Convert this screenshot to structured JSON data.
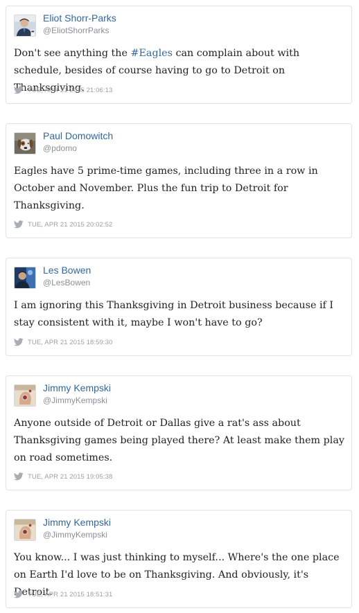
{
  "feed": {
    "tweets": [
      {
        "name": "Eliot Shorr-Parks",
        "handle": "@EliotShorrParks",
        "text_before": "Don't see anything the ",
        "hashtag": "#Eagles",
        "text_after": " can complain about with schedule, besides of course having to go to Detroit on Thanksgiving.",
        "timestamp": "TUE, APR 21 2015 21:06:13",
        "avatar_icon": "person-avatar-icon"
      },
      {
        "name": "Paul Domowitch",
        "handle": "@pdomo",
        "text": "Eagles have 5 prime-time games, including three in a row in October and November. Plus the fun trip to Detroit for Thanksgiving.",
        "timestamp": "TUE, APR 21 2015 20:02:52",
        "avatar_icon": "dog-avatar-icon"
      },
      {
        "name": "Les Bowen",
        "handle": "@LesBowen",
        "text": "I am ignoring this Thanksgiving in Detroit business because if I stay consistent with it, maybe I won't have to go?",
        "timestamp": "TUE, APR 21 2015 18:59:30",
        "avatar_icon": "person-avatar-icon"
      },
      {
        "name": "Jimmy Kempski",
        "handle": "@JimmyKempski",
        "text": "Anyone outside of Detroit or Dallas give a rat's ass about Thanksgiving games being played there? At least make them play on road sometimes.",
        "timestamp": "TUE, APR 21 2015 19:05:38",
        "avatar_icon": "hand-avatar-icon"
      },
      {
        "name": "Jimmy Kempski",
        "handle": "@JimmyKempski",
        "text": "You know... I was just thinking to myself... Where's the one place on Earth I'd love to be on Thanksgiving. And obviously, it's Detroit.",
        "timestamp": "TUE, APR 21 2015 18:51:31",
        "avatar_icon": "hand-avatar-icon"
      }
    ]
  },
  "colors": {
    "link": "#31679f",
    "text": "#222222",
    "muted": "#9a9fa6",
    "border": "#e1e3e6"
  }
}
